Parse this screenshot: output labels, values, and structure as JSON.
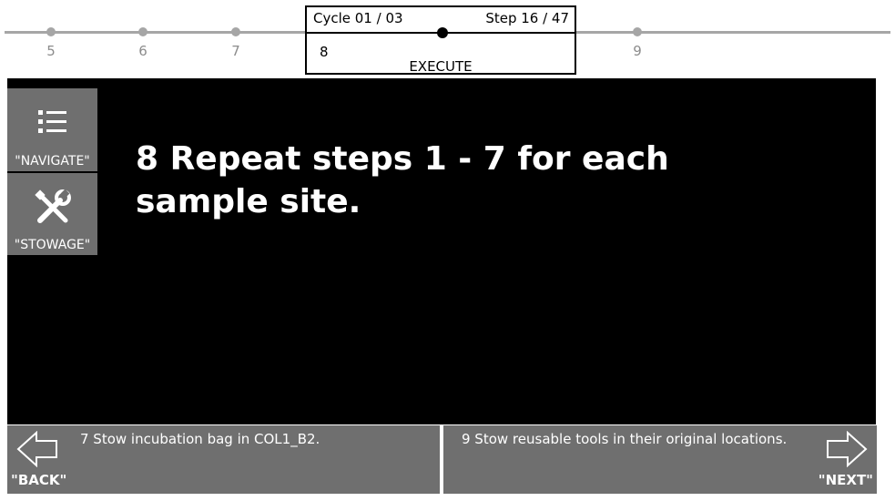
{
  "timeline": {
    "prev_steps": [
      "5",
      "6",
      "7"
    ],
    "next_step": "9",
    "cycle": "Cycle 01 / 03",
    "step": "Step 16 / 47",
    "current_number": "8",
    "current_phase": "EXECUTE"
  },
  "sidebar": {
    "navigate_label": "\"NAVIGATE\"",
    "navigate_icon": "list-icon",
    "stowage_label": "\"STOWAGE\"",
    "stowage_icon": "tools-icon"
  },
  "main": {
    "step_text": "8 Repeat steps 1 - 7 for each sample site."
  },
  "bottom_nav": {
    "back_desc": "7 Stow incubation bag in COL1_B2.",
    "back_label": "\"BACK\"",
    "back_icon": "arrow-left-icon",
    "next_desc": "9 Stow reusable tools in their original locations.",
    "next_label": "\"NEXT\"",
    "next_icon": "arrow-right-icon"
  }
}
